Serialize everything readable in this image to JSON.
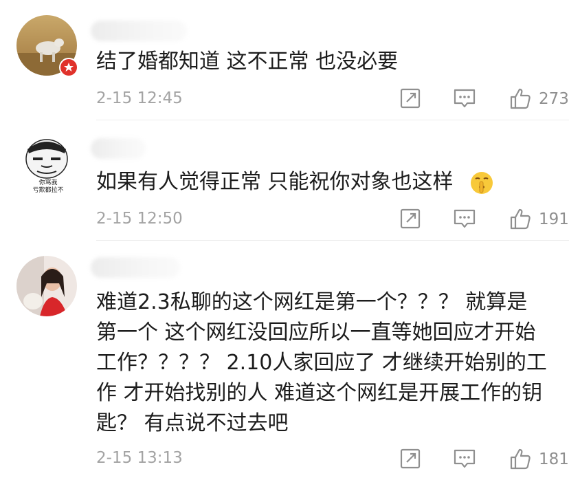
{
  "comments": [
    {
      "text_lines": [
        "结了婚都知道 这不正常 也没必要"
      ],
      "time": "2-15 12:45",
      "likes": "273",
      "avatar_icon": "photo-avatar-icon",
      "badge_icon": "verified-badge-icon"
    },
    {
      "text_lines": [
        "如果有人觉得正常 只能祝你对象也这样"
      ],
      "time": "2-15 12:50",
      "likes": "191",
      "avatar_icon": "meme-face-avatar-icon",
      "avatar_caption": [
        "你骂我",
        "亏欺都拉不"
      ],
      "trailing_emoji": "shush-emoji-icon"
    },
    {
      "text_lines": [
        "难道2.3私聊的这个网红是第一个？？？ 就算是",
        "第一个 这个网红没回应所以一直等她回应才开始",
        "工作？？？？ 2.10人家回应了 才继续开始别的工",
        "作 才开始找别的人 难道这个网红是开展工作的钥",
        "匙？ 有点说不过去吧"
      ],
      "time": "2-15 13:13",
      "likes": "181",
      "avatar_icon": "photo-avatar-icon"
    }
  ],
  "icons": {
    "share": "share-icon",
    "reply": "comment-icon",
    "like": "thumbs-up-icon"
  }
}
